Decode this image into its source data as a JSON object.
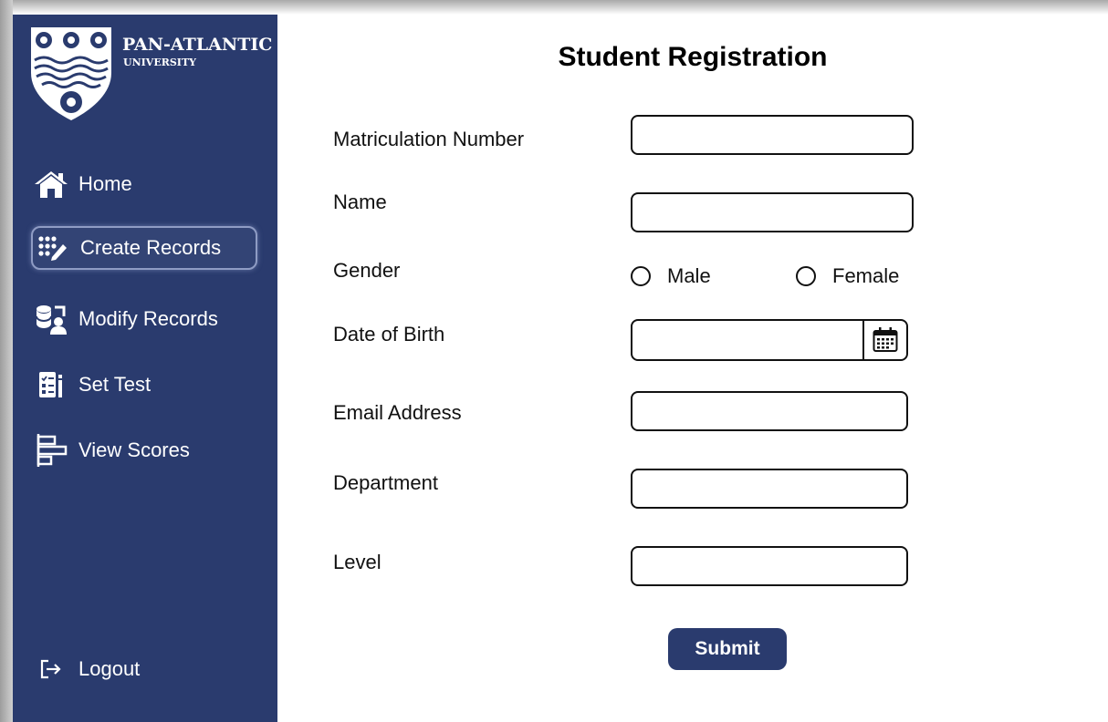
{
  "brand": {
    "name": "PAN-ATLANTIC",
    "sub": "UNIVERSITY"
  },
  "sidebar": {
    "items": [
      {
        "label": "Home",
        "icon": "home-icon",
        "active": false
      },
      {
        "label": "Create Records",
        "icon": "create-records-icon",
        "active": true
      },
      {
        "label": "Modify Records",
        "icon": "modify-records-icon",
        "active": false
      },
      {
        "label": "Set Test",
        "icon": "set-test-icon",
        "active": false
      },
      {
        "label": "View Scores",
        "icon": "view-scores-icon",
        "active": false
      }
    ],
    "logout": {
      "label": "Logout",
      "icon": "logout-icon"
    }
  },
  "form": {
    "title": "Student Registration",
    "fields": {
      "matric": {
        "label": "Matriculation Number",
        "value": ""
      },
      "name": {
        "label": "Name",
        "value": ""
      },
      "gender": {
        "label": "Gender",
        "options": [
          "Male",
          "Female"
        ],
        "selected": ""
      },
      "dob": {
        "label": "Date of Birth",
        "value": "",
        "icon": "calendar-icon"
      },
      "email": {
        "label": "Email Address",
        "value": ""
      },
      "department": {
        "label": "Department",
        "value": ""
      },
      "level": {
        "label": "Level",
        "value": ""
      }
    },
    "submit_label": "Submit"
  },
  "colors": {
    "sidebar_bg": "#2a3b6e",
    "button_bg": "#2a3b6e",
    "text": "#111111"
  }
}
